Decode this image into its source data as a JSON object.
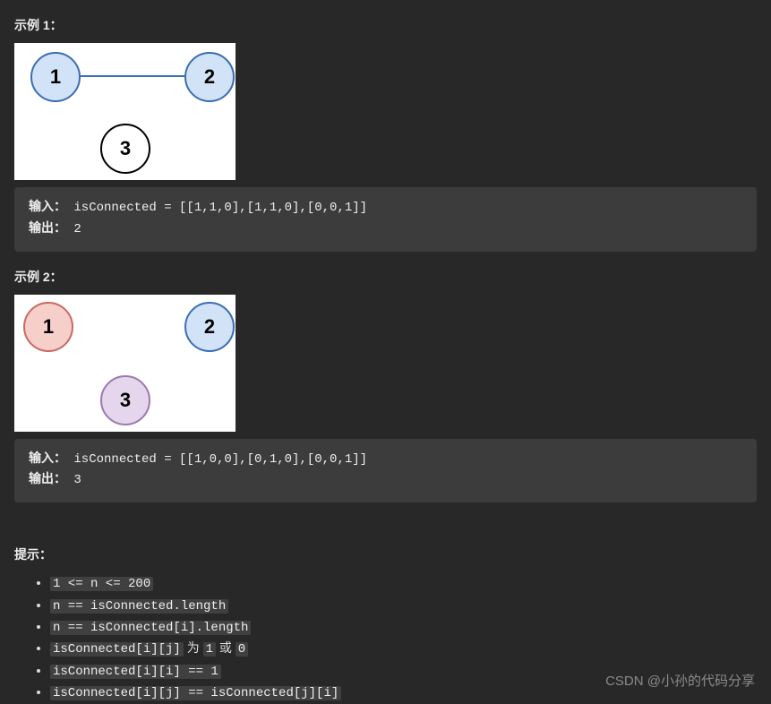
{
  "example1": {
    "heading": "示例 1：",
    "nodes": {
      "n1": "1",
      "n2": "2",
      "n3": "3"
    },
    "input_label": "输入：",
    "input_value": "isConnected = [[1,1,0],[1,1,0],[0,0,1]]",
    "output_label": "输出：",
    "output_value": "2"
  },
  "example2": {
    "heading": "示例 2：",
    "nodes": {
      "n1": "1",
      "n2": "2",
      "n3": "3"
    },
    "input_label": "输入：",
    "input_value": "isConnected = [[1,0,0],[0,1,0],[0,0,1]]",
    "output_label": "输出：",
    "output_value": "3"
  },
  "hints": {
    "heading": "提示：",
    "items": [
      {
        "code": "1 <= n <= 200"
      },
      {
        "code": "n == isConnected.length"
      },
      {
        "code": "n == isConnected[i].length"
      },
      {
        "code_prefix": "isConnected[i][j]",
        "mid1": " 为 ",
        "code_a": "1",
        "mid2": " 或 ",
        "code_b": "0"
      },
      {
        "code": "isConnected[i][i] == 1"
      },
      {
        "code": "isConnected[i][j] == isConnected[j][i]"
      }
    ]
  },
  "watermark": "CSDN @小孙的代码分享"
}
